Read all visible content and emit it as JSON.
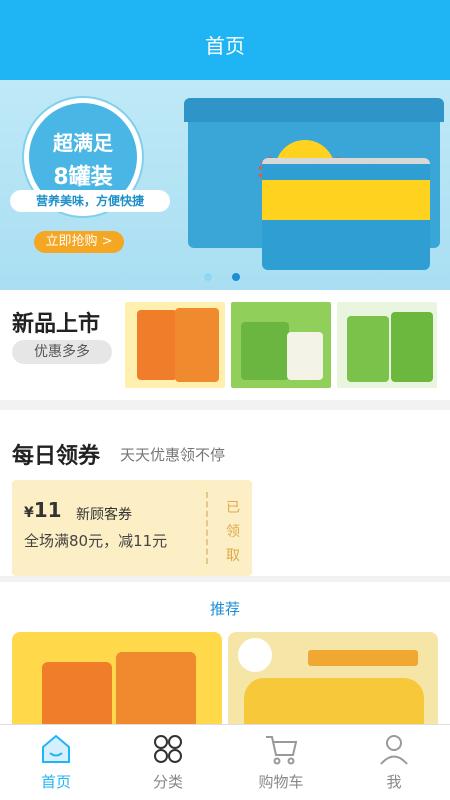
{
  "header": {
    "title": "首页"
  },
  "banner": {
    "badge_line1": "超满足",
    "badge_line2": "8罐装",
    "slogan": "营养美味，方便快捷",
    "buy_label": "立即抢购 >",
    "product_brand": "老鸭暖汤",
    "dots": [
      {
        "active": false
      },
      {
        "active": true
      }
    ]
  },
  "new_arrivals": {
    "title": "新品上市",
    "tag": "优惠多多"
  },
  "coupons": {
    "title": "每日领券",
    "subtitle": "天天优惠领不停",
    "currency": "¥",
    "amount": "11",
    "name": "新顾客券",
    "condition": "全场满80元，减11元",
    "status": "已领取"
  },
  "recommend": {
    "title": "推荐"
  },
  "tabbar": {
    "tabs": [
      {
        "label": "首页",
        "icon": "home-icon",
        "active": true
      },
      {
        "label": "分类",
        "icon": "category-icon",
        "active": false
      },
      {
        "label": "购物车",
        "icon": "cart-icon",
        "active": false
      },
      {
        "label": "我",
        "icon": "user-icon",
        "active": false
      }
    ]
  },
  "colors": {
    "accent": "#1fb5f5",
    "coupon_bg": "#fcefc5",
    "buy_button": "#f5a623"
  }
}
